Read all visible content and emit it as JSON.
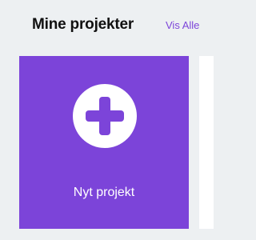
{
  "header": {
    "title": "Mine projekter",
    "view_all_label": "Vis Alle"
  },
  "new_project_card": {
    "label": "Nyt projekt",
    "icon": "plus-icon"
  },
  "colors": {
    "accent": "#7c44d9",
    "background": "#edf0f2",
    "card_next": "#ffffff"
  }
}
